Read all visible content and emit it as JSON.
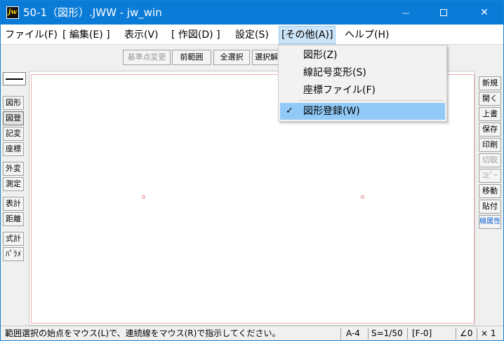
{
  "window": {
    "title": "50-1（図形）.JWW - jw_win",
    "app_icon_text": "jw",
    "min_symbol": "—",
    "close_symbol": "✕"
  },
  "menubar": {
    "file": "ファイル(F)",
    "edit": "[ 編集(E) ]",
    "view": "表示(V)",
    "draw": "[ 作図(D) ]",
    "settings": "設定(S)",
    "other": "[その他(A)]",
    "help": "ヘルプ(H)"
  },
  "toolbar": {
    "base_point": "基準点変更",
    "prev_range": "前範囲",
    "select_all": "全選択",
    "deselect": "選択解除"
  },
  "left_panel": [
    "図形",
    "図登",
    "記変",
    "座標",
    "外変",
    "測定",
    "表計",
    "距離",
    "式計",
    "ﾊﾟﾗﾒ"
  ],
  "right_panel": [
    "新規",
    "開く",
    "上書",
    "保存",
    "印刷",
    "切取",
    "ｺﾋﾟｰ",
    "移動",
    "貼付",
    "線属性"
  ],
  "dropdown": {
    "items": [
      "図形(Z)",
      "線記号変形(S)",
      "座標ファイル(F)",
      "図形登録(W)"
    ],
    "checked_item": "図形登録(W)",
    "check_mark": "✓"
  },
  "status": {
    "message": "範囲選択の始点をマウス(L)で、連続線をマウス(R)で指示してください。",
    "paper": "A-4",
    "scale": "S=1/50",
    "layer": "[F-0]",
    "angle": "∠0",
    "zoom": "× 1"
  },
  "colors": {
    "titlebar": "#0a7bd6",
    "menu_highlight": "#cce4f7",
    "dropdown_highlight": "#91c9f7",
    "frame": "#f0b0b0"
  }
}
